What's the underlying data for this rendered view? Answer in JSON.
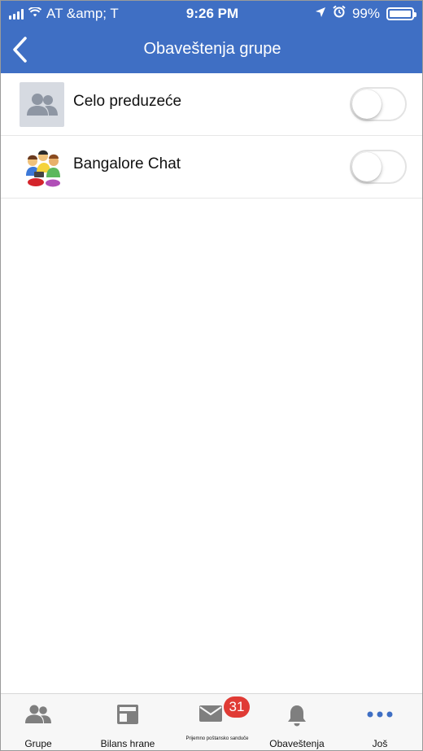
{
  "status_bar": {
    "carrier": "AT &amp; T",
    "time": "9:26 PM",
    "battery_percent": "99%",
    "battery_level": 0.99,
    "icons": [
      "signal-icon",
      "wifi-icon",
      "location-icon",
      "alarm-icon",
      "battery-icon"
    ]
  },
  "navbar": {
    "title": "Obaveštenja grupe",
    "back_icon": "chevron-left-icon"
  },
  "groups": [
    {
      "name": "Celo preduzeće",
      "avatar": "group-placeholder-icon",
      "notifications_on": false
    },
    {
      "name": "Bangalore Chat",
      "avatar": "group-people-avatar",
      "notifications_on": false
    }
  ],
  "tabbar": {
    "tabs": [
      {
        "label": "Grupe",
        "icon": "groups-icon"
      },
      {
        "label": "Bilans hrane",
        "icon": "feed-icon"
      },
      {
        "label": "Prijemno poštansko sanduče",
        "icon": "mail-icon",
        "badge": "31"
      },
      {
        "label": "Obaveštenja",
        "icon": "bell-icon"
      },
      {
        "label": "Još",
        "icon": "more-icon"
      }
    ]
  },
  "colors": {
    "header_blue": "#3f6fc4",
    "badge_red": "#e03b35",
    "tab_icon_gray": "#7f7f7f"
  }
}
